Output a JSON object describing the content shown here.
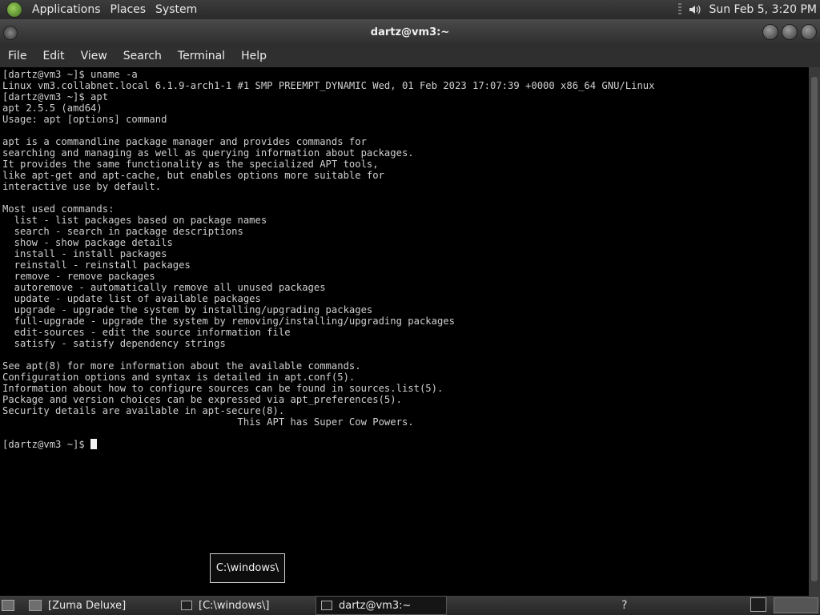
{
  "top_panel": {
    "menus": [
      "Applications",
      "Places",
      "System"
    ],
    "clock": "Sun Feb  5,  3:20 PM",
    "icons": {
      "app": "gnome-foot-icon",
      "volume": "volume-icon"
    }
  },
  "window": {
    "title": "dartz@vm3:~",
    "menu": [
      "File",
      "Edit",
      "View",
      "Search",
      "Terminal",
      "Help"
    ]
  },
  "terminal": {
    "lines": [
      "[dartz@vm3 ~]$ uname -a",
      "Linux vm3.collabnet.local 6.1.9-arch1-1 #1 SMP PREEMPT_DYNAMIC Wed, 01 Feb 2023 17:07:39 +0000 x86_64 GNU/Linux",
      "[dartz@vm3 ~]$ apt",
      "apt 2.5.5 (amd64)",
      "Usage: apt [options] command",
      "",
      "apt is a commandline package manager and provides commands for",
      "searching and managing as well as querying information about packages.",
      "It provides the same functionality as the specialized APT tools,",
      "like apt-get and apt-cache, but enables options more suitable for",
      "interactive use by default.",
      "",
      "Most used commands:",
      "  list - list packages based on package names",
      "  search - search in package descriptions",
      "  show - show package details",
      "  install - install packages",
      "  reinstall - reinstall packages",
      "  remove - remove packages",
      "  autoremove - automatically remove all unused packages",
      "  update - update list of available packages",
      "  upgrade - upgrade the system by installing/upgrading packages",
      "  full-upgrade - upgrade the system by removing/installing/upgrading packages",
      "  edit-sources - edit the source information file",
      "  satisfy - satisfy dependency strings",
      "",
      "See apt(8) for more information about the available commands.",
      "Configuration options and syntax is detailed in apt.conf(5).",
      "Information about how to configure sources can be found in sources.list(5).",
      "Package and version choices can be expressed via apt_preferences(5).",
      "Security details are available in apt-secure(8).",
      "                                        This APT has Super Cow Powers.",
      ""
    ],
    "prompt": "[dartz@vm3 ~]$ "
  },
  "tooltip": {
    "text": "C:\\windows\\"
  },
  "taskbar": {
    "tasks": [
      {
        "label": "[Zuma Deluxe]",
        "icon": "folder-icon"
      },
      {
        "label": "[C:\\windows\\]",
        "icon": "wine-window-icon"
      },
      {
        "label": "dartz@vm3:~",
        "icon": "terminal-icon"
      }
    ],
    "tray_help": "?"
  }
}
